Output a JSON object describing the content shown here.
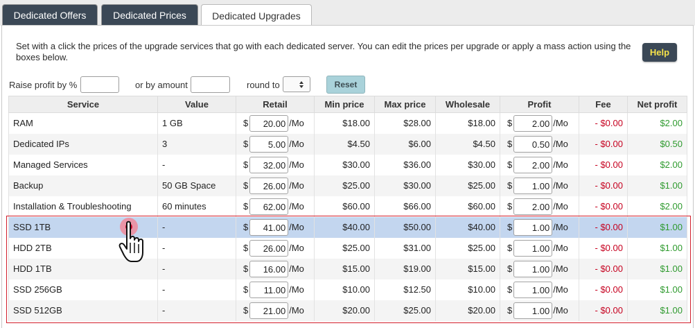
{
  "tabs": [
    {
      "label": "Dedicated Offers"
    },
    {
      "label": "Dedicated Prices"
    },
    {
      "label": "Dedicated Upgrades"
    }
  ],
  "intro_text": "Set with a click the prices of the upgrade services that go with each dedicated server. You can edit the prices per upgrade or apply a mass action using the boxes below.",
  "help_label": "Help",
  "controls": {
    "raise_profit_label": "Raise profit by %",
    "raise_profit_value": "",
    "by_amount_label": "or by amount",
    "by_amount_value": "",
    "round_to_label": "round to",
    "round_to_value": "",
    "reset_label": "Reset"
  },
  "table": {
    "columns": [
      "Service",
      "Value",
      "Retail",
      "Min price",
      "Max price",
      "Wholesale",
      "Profit",
      "Fee",
      "Net profit"
    ],
    "currency": "$",
    "unit": "/Mo",
    "rows": [
      {
        "service": "RAM",
        "value": "1 GB",
        "retail": "20.00",
        "min": "$18.00",
        "max": "$28.00",
        "wholesale": "$18.00",
        "profit": "2.00",
        "fee": "- $0.00",
        "net": "$2.00"
      },
      {
        "service": "Dedicated IPs",
        "value": "3",
        "retail": "5.00",
        "min": "$4.50",
        "max": "$6.00",
        "wholesale": "$4.50",
        "profit": "0.50",
        "fee": "- $0.00",
        "net": "$0.50"
      },
      {
        "service": "Managed Services",
        "value": "-",
        "retail": "32.00",
        "min": "$30.00",
        "max": "$36.00",
        "wholesale": "$30.00",
        "profit": "2.00",
        "fee": "- $0.00",
        "net": "$2.00"
      },
      {
        "service": "Backup",
        "value": "50 GB Space",
        "retail": "26.00",
        "min": "$25.00",
        "max": "$30.00",
        "wholesale": "$25.00",
        "profit": "1.00",
        "fee": "- $0.00",
        "net": "$1.00"
      },
      {
        "service": "Installation & Troubleshooting",
        "value": "60 minutes",
        "retail": "62.00",
        "min": "$60.00",
        "max": "$66.00",
        "wholesale": "$60.00",
        "profit": "2.00",
        "fee": "- $0.00",
        "net": "$2.00"
      },
      {
        "service": "SSD 1TB",
        "value": "-",
        "retail": "41.00",
        "min": "$40.00",
        "max": "$50.00",
        "wholesale": "$40.00",
        "profit": "1.00",
        "fee": "- $0.00",
        "net": "$1.00"
      },
      {
        "service": "HDD 2TB",
        "value": "-",
        "retail": "26.00",
        "min": "$25.00",
        "max": "$31.00",
        "wholesale": "$25.00",
        "profit": "1.00",
        "fee": "- $0.00",
        "net": "$1.00"
      },
      {
        "service": "HDD 1TB",
        "value": "-",
        "retail": "16.00",
        "min": "$15.00",
        "max": "$19.00",
        "wholesale": "$15.00",
        "profit": "1.00",
        "fee": "- $0.00",
        "net": "$1.00"
      },
      {
        "service": "SSD 256GB",
        "value": "-",
        "retail": "11.00",
        "min": "$10.00",
        "max": "$12.50",
        "wholesale": "$10.00",
        "profit": "1.00",
        "fee": "- $0.00",
        "net": "$1.00"
      },
      {
        "service": "SSD 512GB",
        "value": "-",
        "retail": "21.00",
        "min": "$20.00",
        "max": "$25.00",
        "wholesale": "$20.00",
        "profit": "1.00",
        "fee": "- $0.00",
        "net": "$1.00"
      }
    ]
  },
  "colors": {
    "tab_dark": "#3b4856",
    "help_text": "#f6e24a",
    "reset_bg": "#a9d2da",
    "selected_row": "#c3d6ef",
    "fee_red": "#c6001f",
    "net_green": "#2e9a2e",
    "highlight_frame": "#d21e2b"
  },
  "icons": [
    "hand-pointer-cursor-icon",
    "dropdown-arrows-icon"
  ]
}
